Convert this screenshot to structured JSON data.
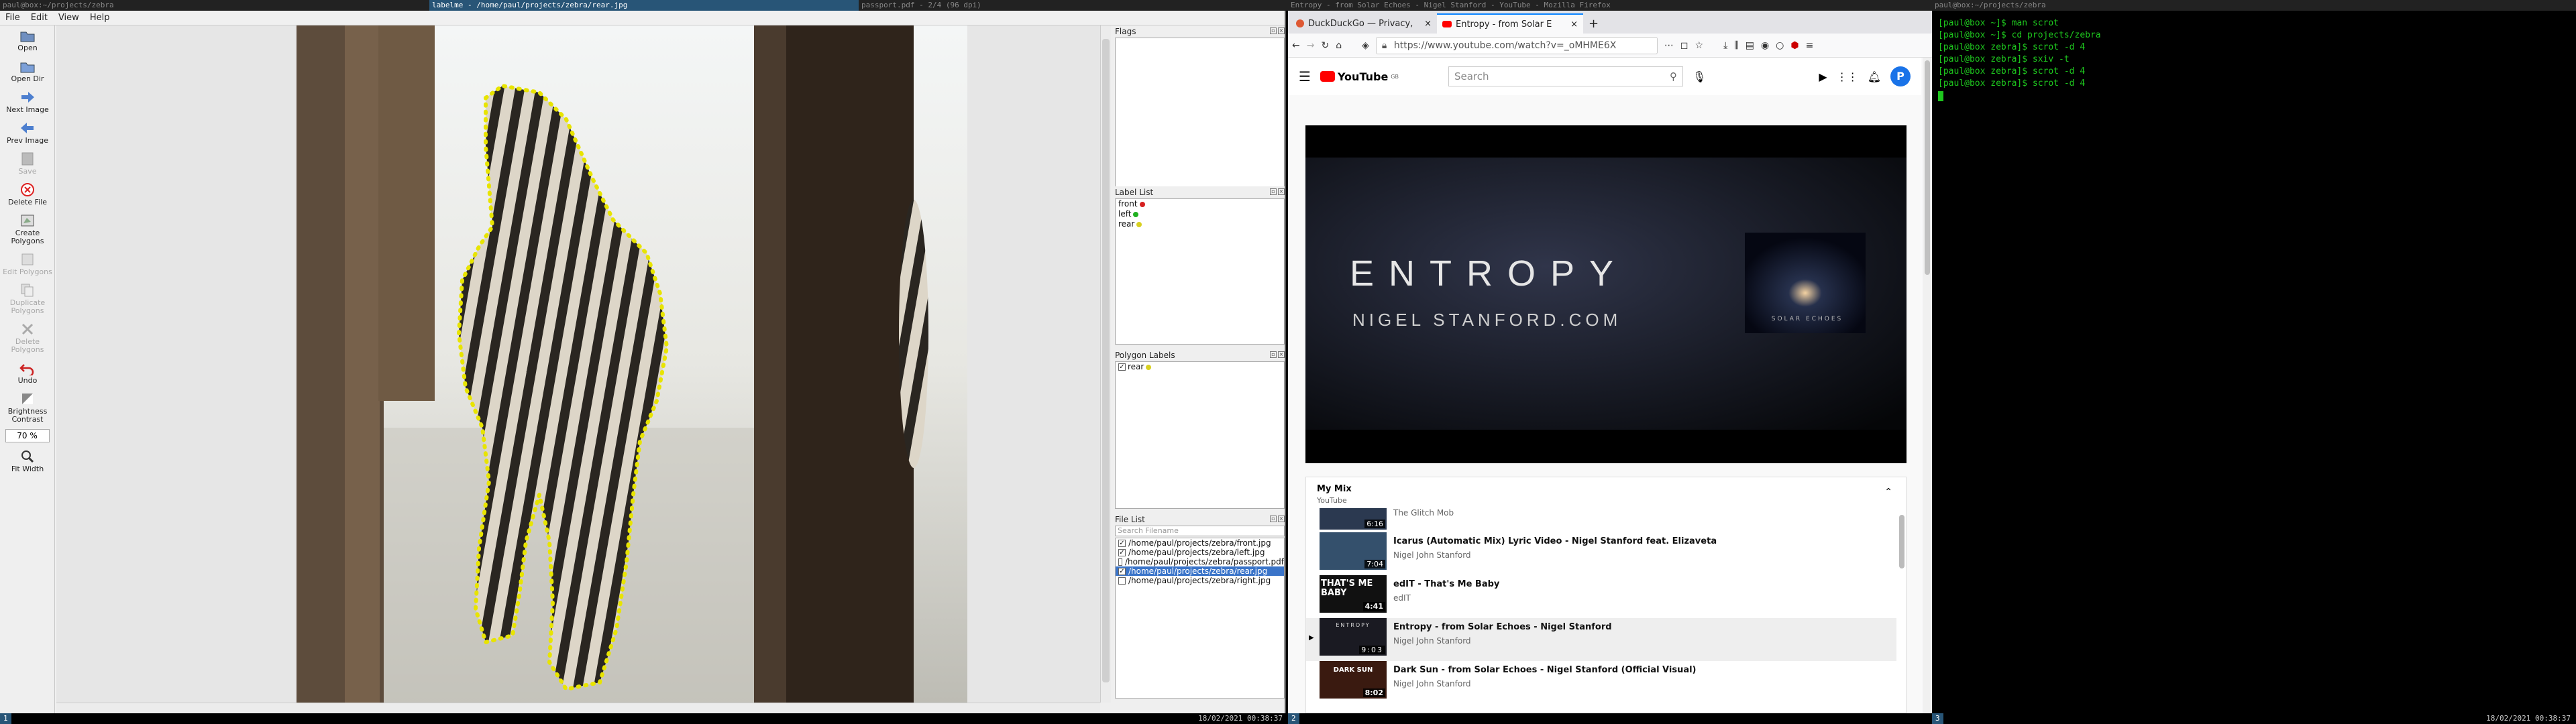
{
  "titles": {
    "left_small": "paul@box:~/projects/zebra",
    "labelme": "labelme - /home/paul/projects/zebra/rear.jpg",
    "zathura": "passport.pdf - 2/4 (96 dpi)",
    "firefox": "Entropy - from Solar Echoes - Nigel Stanford - YouTube - Mozilla Firefox",
    "terminal": "paul@box:~/projects/zebra"
  },
  "labelme": {
    "menu": [
      "File",
      "Edit",
      "View",
      "Help"
    ],
    "tools": {
      "open": "Open",
      "open_dir": "Open Dir",
      "next": "Next Image",
      "prev": "Prev Image",
      "save": "Save",
      "delete_file": "Delete File",
      "create": "Create Polygons",
      "edit": "Edit Polygons",
      "duplicate": "Duplicate Polygons",
      "delete_poly": "Delete Polygons",
      "undo": "Undo",
      "brightness": "Brightness Contrast",
      "zoom": "70 %",
      "fit_width": "Fit Width"
    },
    "docks": {
      "flags": "Flags",
      "label_list": "Label List",
      "polygon_labels": "Polygon Labels",
      "file_list": "File List",
      "search_placeholder": "Search Filename"
    },
    "labels": [
      {
        "name": "front",
        "color": "#d62020"
      },
      {
        "name": "left",
        "color": "#20b020"
      },
      {
        "name": "rear",
        "color": "#d8d020"
      }
    ],
    "polygon_labels": [
      {
        "name": "rear",
        "checked": "✓",
        "color": "#d8d020"
      }
    ],
    "files": [
      {
        "path": "/home/paul/projects/zebra/front.jpg",
        "checked": "✓"
      },
      {
        "path": "/home/paul/projects/zebra/left.jpg",
        "checked": "✓"
      },
      {
        "path": "/home/paul/projects/zebra/passport.pdf",
        "checked": ""
      },
      {
        "path": "/home/paul/projects/zebra/rear.jpg",
        "checked": "✓"
      },
      {
        "path": "/home/paul/projects/zebra/right.jpg",
        "checked": ""
      }
    ],
    "polygon_color": "#e8e400"
  },
  "firefox": {
    "tabs": [
      {
        "title": "DuckDuckGo — Privacy,",
        "close": "×"
      },
      {
        "title": "Entropy - from Solar E",
        "close": "×"
      }
    ],
    "new_tab": "+",
    "url": "https://www.youtube.com/watch?v=_oMHME6X",
    "youtube": {
      "logo": "YouTube",
      "logo_sup": "GB",
      "search_placeholder": "Search",
      "avatar": "P",
      "video_title": "ENTROPY",
      "video_sub": "NIGEL STANFORD.COM",
      "album_text": "SOLAR ECHOES",
      "mix_title": "My Mix",
      "mix_sub": "YouTube",
      "items": [
        {
          "title": "",
          "artist": "The Glitch Mob",
          "dur": "6:16",
          "thumb": "",
          "bg": "#2b3950"
        },
        {
          "title": "Icarus (Automatic Mix) Lyric Video - Nigel Stanford feat. Elizaveta",
          "artist": "Nigel John Stanford",
          "dur": "7:04",
          "thumb": "",
          "bg": "#34506c"
        },
        {
          "title": "edIT - That's Me Baby",
          "artist": "edIT",
          "dur": "4:41",
          "thumb": "THAT'S ME BABY",
          "bg": "#111"
        },
        {
          "title": "Entropy - from Solar Echoes - Nigel Stanford",
          "artist": "Nigel John Stanford",
          "dur": "9:03",
          "thumb": "ENTROPY",
          "bg": "#1a1a22"
        },
        {
          "title": "Dark Sun - from Solar Echoes - Nigel Stanford (Official Visual)",
          "artist": "Nigel John Stanford",
          "dur": "8:02",
          "thumb": "DARK SUN",
          "bg": "#3a1a10"
        }
      ]
    }
  },
  "terminal": {
    "lines": [
      "[paul@box ~]$ man scrot",
      "[paul@box ~]$ cd projects/zebra",
      "[paul@box zebra]$ scrot -d 4",
      "[paul@box zebra]$ sxiv -t",
      "[paul@box zebra]$ scrot -d 4",
      "[paul@box zebra]$ scrot -d 4"
    ]
  },
  "statusbar": {
    "ws1": "1",
    "ws2": "2",
    "ws3": "3",
    "time": "18/02/2021 00:38:37"
  }
}
